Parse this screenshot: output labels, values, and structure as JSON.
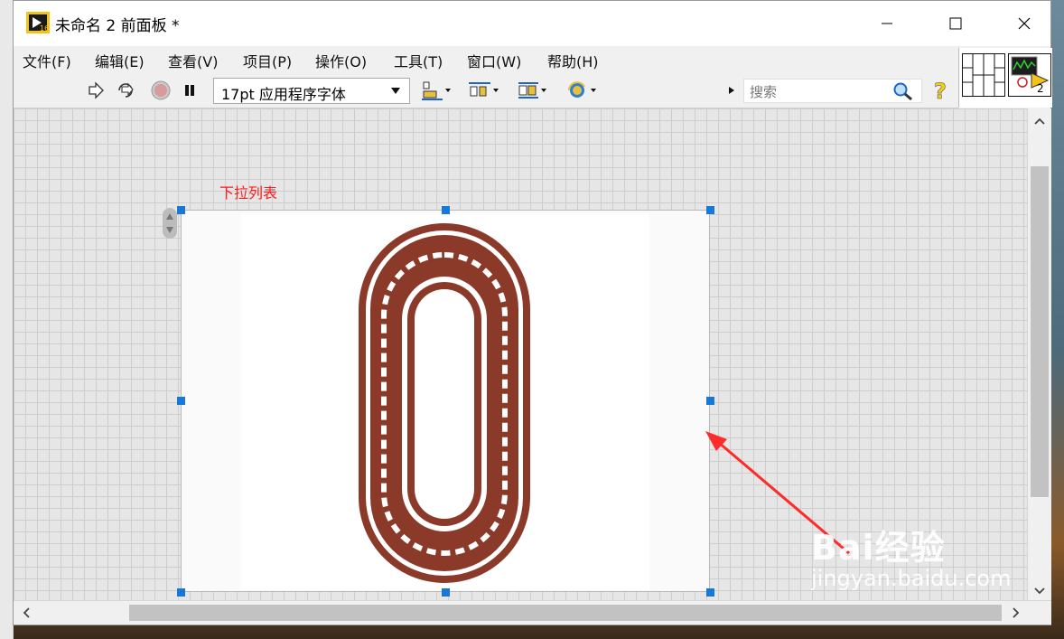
{
  "window": {
    "title": "未命名 2 前面板 *",
    "controls": [
      "minimize",
      "maximize",
      "close"
    ]
  },
  "menu": [
    {
      "label": "文件(F)"
    },
    {
      "label": "编辑(E)"
    },
    {
      "label": "查看(V)"
    },
    {
      "label": "项目(P)"
    },
    {
      "label": "操作(O)"
    },
    {
      "label": "工具(T)"
    },
    {
      "label": "窗口(W)"
    },
    {
      "label": "帮助(H)"
    }
  ],
  "toolbar": {
    "font_select": "17pt 应用程序字体",
    "search_placeholder": "搜索"
  },
  "connector": {
    "pane_number": "2"
  },
  "front_panel": {
    "control_label": "下拉列表"
  },
  "watermark": {
    "logo_text": "Bai经验",
    "url": "jingyan.baidu.com"
  },
  "colors": {
    "handle": "#1878d8",
    "label": "#ff1a1a",
    "ornament": "#8b3a2a",
    "annotation_arrow": "#ff2a2a"
  }
}
